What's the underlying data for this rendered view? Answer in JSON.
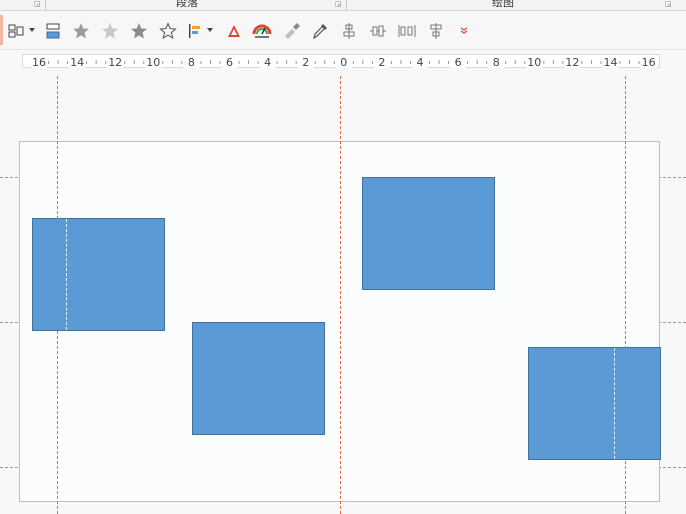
{
  "ribbon": {
    "groups": [
      {
        "label": "段落"
      },
      {
        "label": "绘图"
      }
    ]
  },
  "toolbar": {
    "buttons": [
      {
        "name": "arrange-objects-button",
        "icon": "arrange-icon",
        "has_dropdown": true
      },
      {
        "name": "align-group-button",
        "icon": "align-group-icon",
        "has_dropdown": false
      },
      {
        "name": "star-button-1",
        "icon": "star-filled-gray-icon",
        "has_dropdown": false
      },
      {
        "name": "star-button-2",
        "icon": "star-light-gray-icon",
        "has_dropdown": false
      },
      {
        "name": "star-button-3",
        "icon": "star-filled-gray-icon",
        "has_dropdown": false
      },
      {
        "name": "star-outline-button",
        "icon": "star-outline-icon",
        "has_dropdown": false
      },
      {
        "name": "text-align-button",
        "icon": "text-align-icon",
        "has_dropdown": true
      },
      {
        "name": "pdf-button",
        "icon": "pdf-icon",
        "has_dropdown": false
      },
      {
        "name": "speed-button",
        "icon": "gauge-icon",
        "has_dropdown": false
      },
      {
        "name": "format-painter-button",
        "icon": "paintbrush-icon",
        "has_dropdown": false
      },
      {
        "name": "eyedropper-button",
        "icon": "eyedropper-icon",
        "has_dropdown": false
      },
      {
        "name": "align-center-vertical-button",
        "icon": "align-center-icon",
        "has_dropdown": false
      },
      {
        "name": "distribute-horizontal-button",
        "icon": "distribute-h-icon",
        "has_dropdown": false
      },
      {
        "name": "distribute-spacing-button",
        "icon": "distribute-spacing-icon",
        "has_dropdown": false
      },
      {
        "name": "align-middle-button",
        "icon": "align-middle-icon",
        "has_dropdown": false
      },
      {
        "name": "more-button",
        "icon": "more-icon",
        "has_dropdown": true
      }
    ]
  },
  "ruler": {
    "labels": [
      "16",
      "14",
      "12",
      "10",
      "8",
      "6",
      "4",
      "2",
      "0",
      "2",
      "4",
      "6",
      "8",
      "10",
      "12",
      "14",
      "16"
    ]
  },
  "colors": {
    "shape_fill": "#5b9bd5",
    "shape_border": "#41719c",
    "guide_vertical": "#e06a4a",
    "guide_horizontal": "#9a9a9a",
    "pdf_icon": "#e0442c"
  }
}
